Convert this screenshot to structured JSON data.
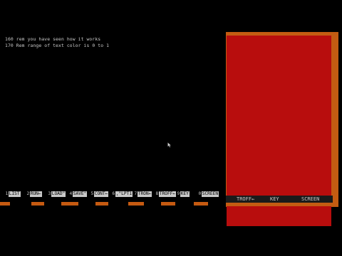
{
  "editor": {
    "lines": [
      "160 rem you have seen how it works",
      "170 Rem range of text color is 0 to 1"
    ]
  },
  "function_keys": [
    {
      "num": "1",
      "label": "LIST"
    },
    {
      "num": "2",
      "label": "RUN←"
    },
    {
      "num": "3",
      "label": "LOAD\""
    },
    {
      "num": "4",
      "label": "SAVE\""
    },
    {
      "num": "5",
      "label": "CONT←"
    },
    {
      "num": "6",
      "label": ",\"LPT1"
    },
    {
      "num": "7",
      "label": "TRON←"
    },
    {
      "num": "8",
      "label": "TROFF←"
    },
    {
      "num": "9",
      "label": "KEY"
    },
    {
      "num": "0",
      "label": "SCREEN"
    }
  ],
  "graphics_window": {
    "status_buttons": [
      "TROFF←",
      "KEY",
      "SCREEN"
    ]
  },
  "colors": {
    "background": "#000000",
    "text": "#c9c9c9",
    "canvas_red": "#b80d0d",
    "frame_orange": "#c45c12"
  },
  "icons": {
    "mouse_cursor": "arrow-pointer-icon"
  }
}
